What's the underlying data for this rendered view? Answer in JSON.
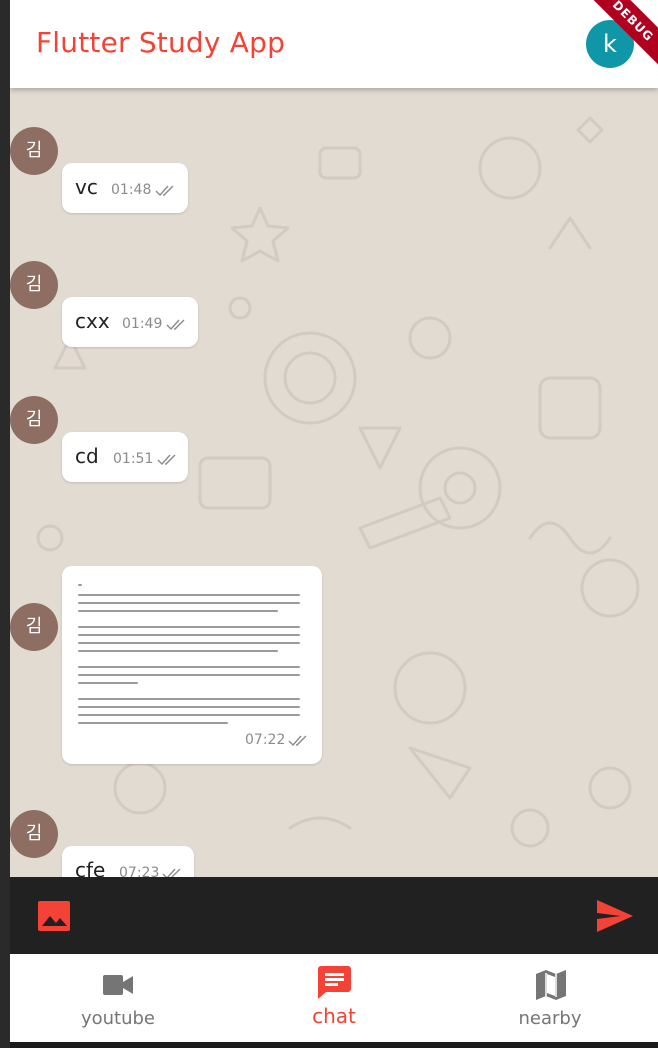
{
  "appbar": {
    "title": "Flutter Study App",
    "avatar_letter": "k",
    "debug_banner": "DEBUG"
  },
  "colors": {
    "accent": "#f44336",
    "avatar": "#0f97a8",
    "sender_avatar": "#8e6e62",
    "chat_bg": "#e2dbd2",
    "input_bar": "#212121",
    "nav_inactive": "#757575"
  },
  "messages": [
    {
      "sender": "김",
      "text": "vc",
      "time": "01:48"
    },
    {
      "sender": "김",
      "text": "cxx",
      "time": "01:49"
    },
    {
      "sender": "김",
      "text": "cd",
      "time": "01:51"
    },
    {
      "sender": "김",
      "type": "image",
      "time": "07:22"
    },
    {
      "sender": "김",
      "text": "cfe",
      "time": "07:23"
    }
  ],
  "inputbar": {
    "image_button_icon": "image-icon",
    "send_button_icon": "send-icon"
  },
  "bottom_nav": {
    "items": [
      {
        "label": "youtube",
        "icon": "videocam-icon",
        "active": false
      },
      {
        "label": "chat",
        "icon": "chat-icon",
        "active": true
      },
      {
        "label": "nearby",
        "icon": "map-icon",
        "active": false
      }
    ]
  }
}
